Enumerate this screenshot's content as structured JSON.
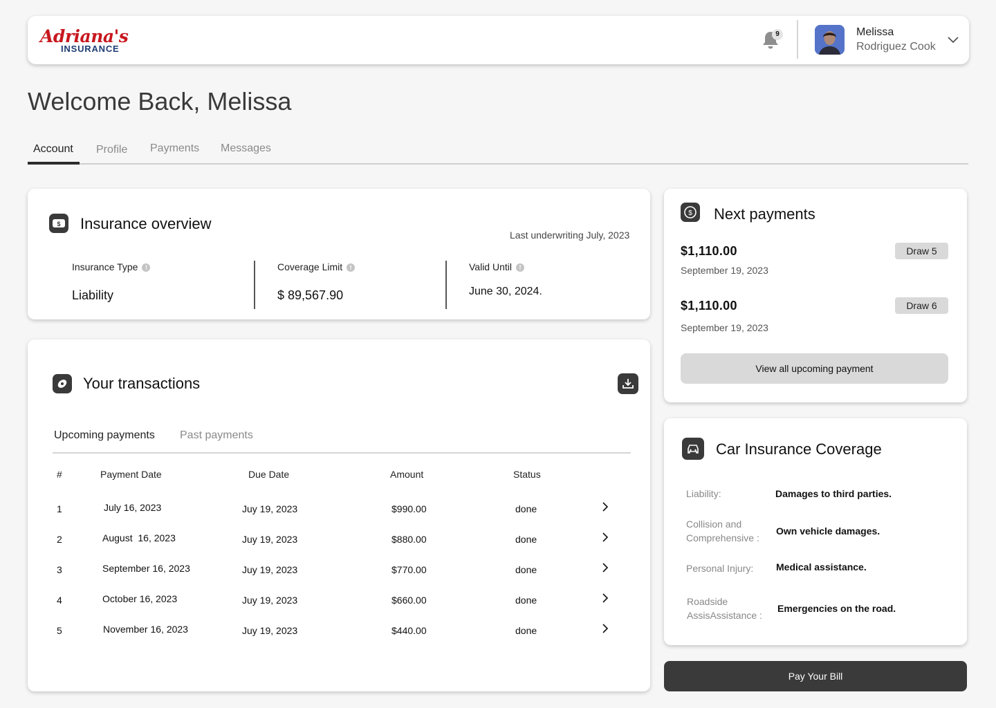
{
  "brand": {
    "logo_script": "Adriana's",
    "logo_sub": "INSURANCE",
    "primary_color": "#c8171e",
    "secondary_color": "#1d3b73"
  },
  "header": {
    "notification_count": "9",
    "user_first_name": "Melissa",
    "user_last_name": "Rodriguez Cook"
  },
  "welcome": "Welcome Back, Melissa",
  "tabs": [
    {
      "label": "Account",
      "active": true
    },
    {
      "label": "Profile",
      "active": false
    },
    {
      "label": "Payments",
      "active": false
    },
    {
      "label": "Messages",
      "active": false
    }
  ],
  "overview": {
    "title": "Insurance overview",
    "last_underwriting": "Last underwriting July, 2023",
    "items": [
      {
        "label": "Insurance Type",
        "value": "Liability"
      },
      {
        "label": "Coverage Limit",
        "value": "$ 89,567.90"
      },
      {
        "label": "Valid Until",
        "value": "June 30, 2024."
      }
    ]
  },
  "transactions": {
    "title": "Your transactions",
    "subtabs": [
      {
        "label": "Upcoming payments",
        "active": true
      },
      {
        "label": "Past payments",
        "active": false
      }
    ],
    "columns": [
      "#",
      "Payment Date",
      "Due Date",
      "Amount",
      "Status"
    ],
    "rows": [
      {
        "num": "1",
        "payment_date": "July 16, 2023",
        "due_date": "Juy 19, 2023",
        "amount": "$990.00",
        "status": "done"
      },
      {
        "num": "2",
        "payment_date": "August  16, 2023",
        "due_date": "Juy 19, 2023",
        "amount": "$880.00",
        "status": "done"
      },
      {
        "num": "3",
        "payment_date": "September 16, 2023",
        "due_date": "Juy 19, 2023",
        "amount": "$770.00",
        "status": "done"
      },
      {
        "num": "4",
        "payment_date": "October 16, 2023",
        "due_date": "Juy 19, 2023",
        "amount": "$660.00",
        "status": "done"
      },
      {
        "num": "5",
        "payment_date": "November 16, 2023",
        "due_date": "Juy 19, 2023",
        "amount": "$440.00",
        "status": "done"
      }
    ]
  },
  "next_payments": {
    "title": "Next payments",
    "items": [
      {
        "amount": "$1,110.00",
        "date": "September 19, 2023",
        "draw": "Draw 5"
      },
      {
        "amount": "$1,110.00",
        "date": "September 19, 2023",
        "draw": "Draw 6"
      }
    ],
    "view_all_label": "View all upcoming payment"
  },
  "coverage": {
    "title": "Car Insurance Coverage",
    "items": [
      {
        "label_line1": "Liability:",
        "label_line2": "",
        "value": "Damages to third parties."
      },
      {
        "label_line1": "Collision and",
        "label_line2": "Comprehensive :",
        "value": "Own vehicle damages."
      },
      {
        "label_line1": "Personal Injury:",
        "label_line2": "",
        "value": "Medical assistance."
      },
      {
        "label_line1": "Roadside",
        "label_line2": "AssisAssistance :",
        "value": "Emergencies on the road."
      }
    ]
  },
  "pay_bill_label": "Pay Your Bill"
}
